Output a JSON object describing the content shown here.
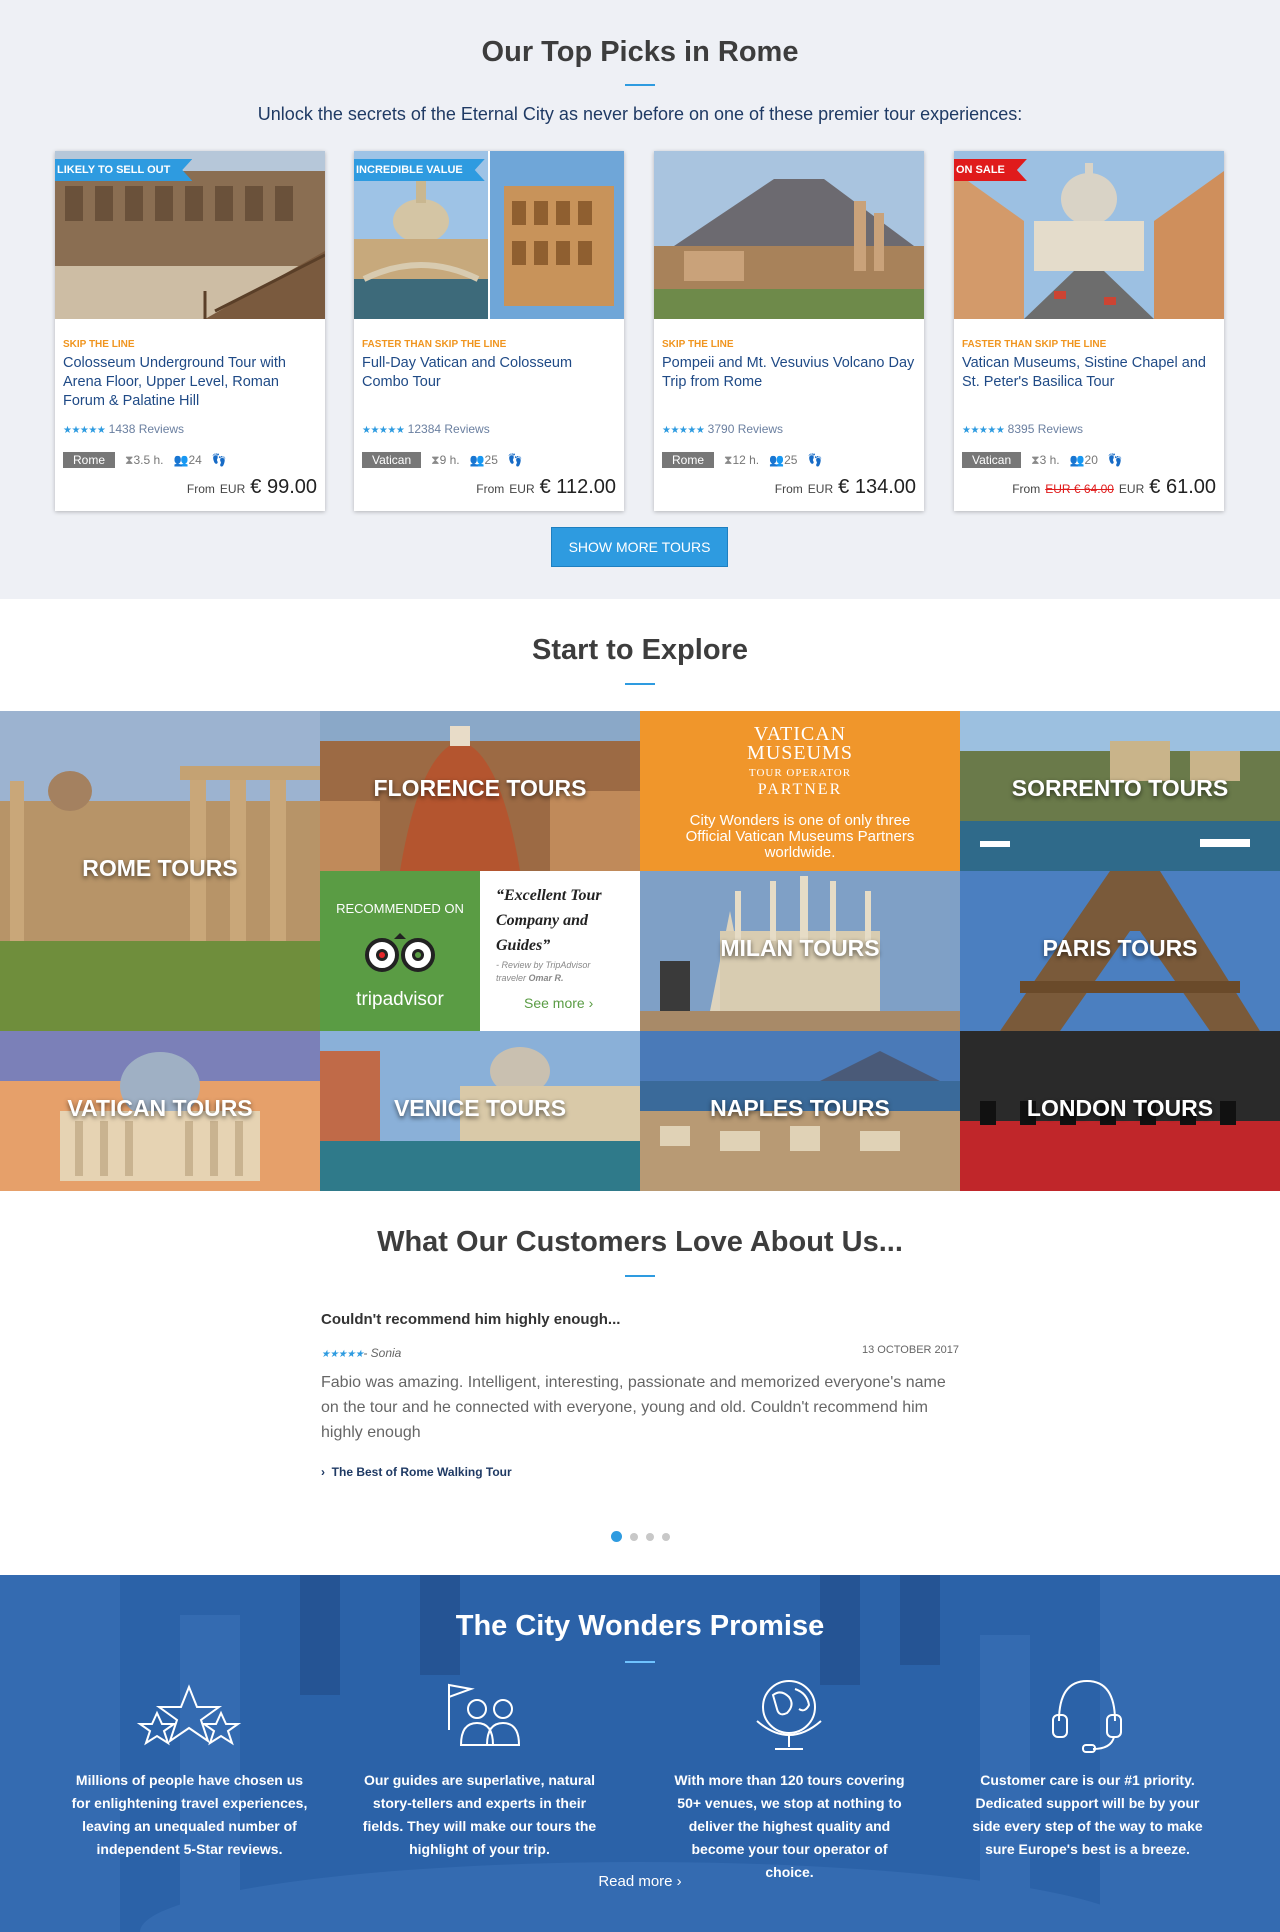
{
  "top_picks": {
    "title": "Our Top Picks in Rome",
    "subtitle": "Unlock the secrets of the Eternal City as never before on one of these premier tour experiences:",
    "tours": [
      {
        "badge": "LIKELY TO SELL OUT",
        "badge_color": "#2e9be0",
        "tag": "SKIP THE LINE",
        "name": "Colosseum Underground Tour with Arena Floor, Upper Level, Roman Forum & Palatine Hill",
        "stars": "★★★★★",
        "reviews": "1438 Reviews",
        "location": "Rome",
        "duration": "3.5 h.",
        "group": "24",
        "from": "From",
        "currency": "EUR",
        "old_price": "",
        "price": "€ 99.00"
      },
      {
        "badge": "INCREDIBLE VALUE",
        "badge_color": "#2e9be0",
        "tag": "FASTER THAN SKIP THE LINE",
        "name": "Full-Day Vatican and Colosseum Combo Tour",
        "stars": "★★★★★",
        "reviews": "12384 Reviews",
        "location": "Vatican",
        "duration": "9 h.",
        "group": "25",
        "from": "From",
        "currency": "EUR",
        "old_price": "",
        "price": "€ 112.00"
      },
      {
        "badge": "",
        "badge_color": "",
        "tag": "SKIP THE LINE",
        "name": "Pompeii and Mt. Vesuvius Volcano Day Trip from Rome",
        "stars": "★★★★★",
        "reviews": "3790 Reviews",
        "location": "Rome",
        "duration": "12 h.",
        "group": "25",
        "from": "From",
        "currency": "EUR",
        "old_price": "",
        "price": "€ 134.00"
      },
      {
        "badge": "ON SALE",
        "badge_color": "#e01b1b",
        "tag": "FASTER THAN SKIP THE LINE",
        "name": "Vatican Museums, Sistine Chapel and St. Peter's Basilica Tour",
        "stars": "★★★★★",
        "reviews": "8395 Reviews",
        "location": "Vatican",
        "duration": "3 h.",
        "group": "20",
        "from": "From",
        "currency": "EUR",
        "old_price": "EUR € 64.00",
        "price": "€ 61.00"
      }
    ],
    "show_more": "SHOW MORE TOURS"
  },
  "explore": {
    "title": "Start to Explore",
    "rome": "ROME TOURS",
    "florence": "FLORENCE TOURS",
    "sorrento": "SORRENTO TOURS",
    "milan": "MILAN TOURS",
    "paris": "PARIS TOURS",
    "vatican_tours": "VATICAN TOURS",
    "venice": "VENICE TOURS",
    "naples": "NAPLES TOURS",
    "london": "LONDON TOURS",
    "vatican_partner": {
      "line1": "VATICAN",
      "line2": "MUSEUMS",
      "line3": "TOUR OPERATOR",
      "line4": "PARTNER",
      "text": "City Wonders is one of only three Official Vatican Museums Partners worldwide."
    },
    "tripadvisor": {
      "recommended": "RECOMMENDED ON",
      "brand": "tripadvisor",
      "quote": "“Excellent Tour Company and Guides”",
      "byline": "- Review by TripAdvisor traveler",
      "author": "Omar R.",
      "see_more": "See more ›"
    }
  },
  "reviews": {
    "title": "What Our Customers Love About Us...",
    "items": [
      {
        "headline": "Couldn't recommend him highly enough...",
        "stars": "★★★★★",
        "author": "- Sonia",
        "date": "13 OCTOBER 2017",
        "body": "Fabio was amazing. Intelligent, interesting, passionate and memorized everyone's name on the tour and he connected with everyone, young and old. Couldn't recommend him highly enough",
        "tour_link": "The Best of Rome Walking Tour"
      }
    ],
    "pagination": {
      "total": 4,
      "active": 1
    }
  },
  "promise": {
    "title": "The City Wonders Promise",
    "columns": [
      {
        "icon": "stars-icon",
        "text": "Millions of people have chosen us for enlightening travel experiences, leaving an unequaled number of independent 5-Star reviews."
      },
      {
        "icon": "guides-icon",
        "text": "Our guides are superlative, natural story-tellers and experts in their fields. They will make our tours the highlight of your trip."
      },
      {
        "icon": "globe-icon",
        "text": "With more than 120 tours covering 50+ venues, we stop at nothing to deliver the highest quality and become your tour operator of choice."
      },
      {
        "icon": "headset-icon",
        "text": "Customer care is our #1 priority. Dedicated support will be by your side every step of the way to make sure Europe's best is a breeze."
      }
    ],
    "read_more": "Read more ›"
  },
  "colors": {
    "accent": "#2e9be0",
    "orange": "#f0951f",
    "navy": "#1f3a64",
    "sale_red": "#e01b1b",
    "tripadvisor_green": "#5a9c44",
    "vatican_orange": "#f0962b",
    "promise_blue": "#2a62aa"
  }
}
